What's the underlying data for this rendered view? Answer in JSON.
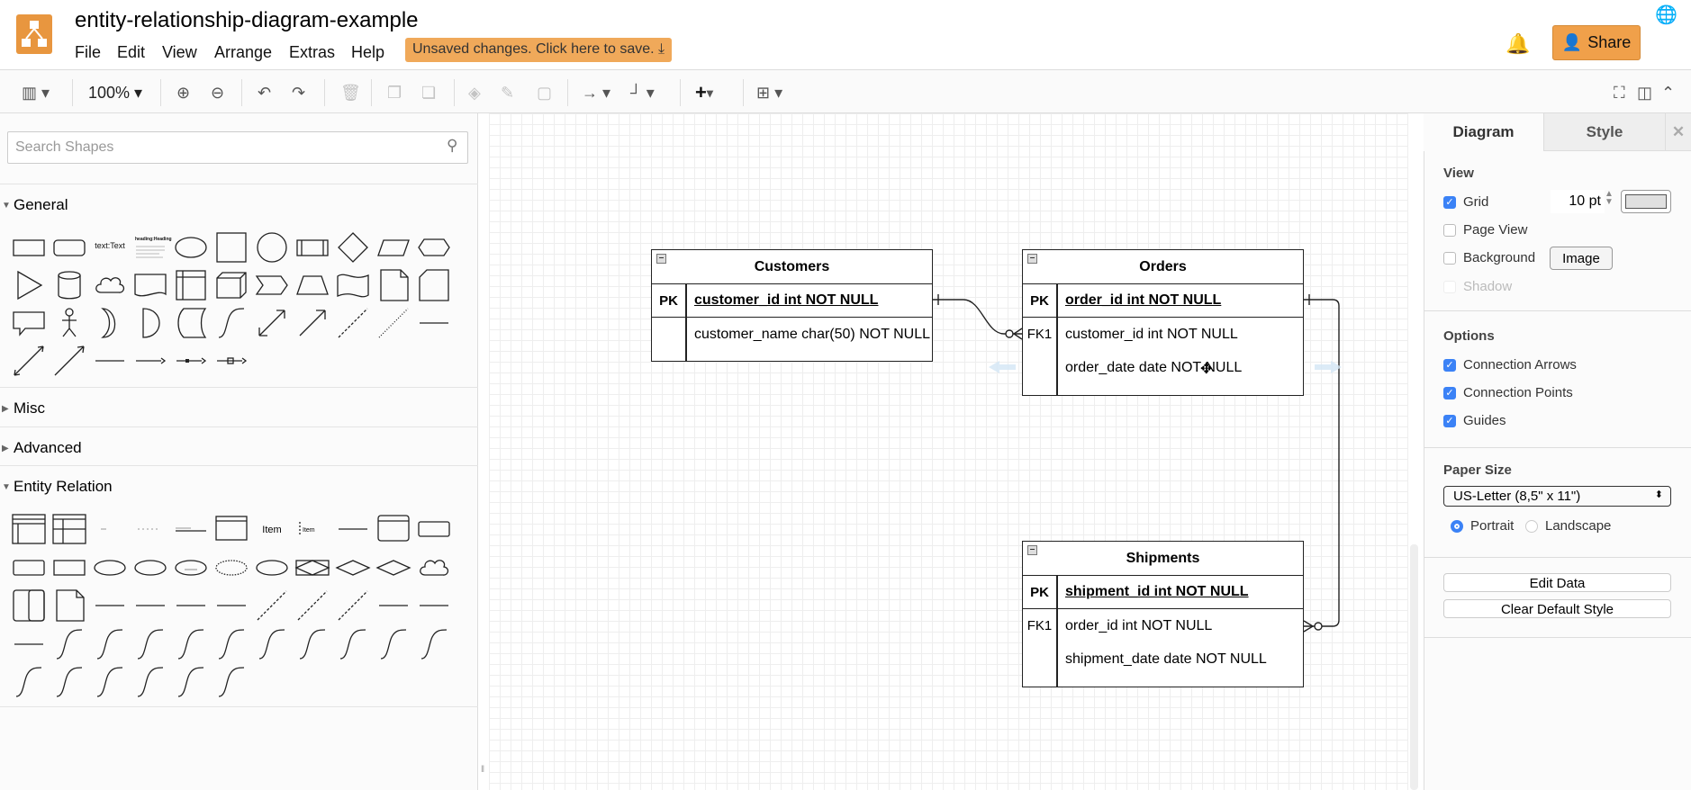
{
  "app": {
    "title": "entity-relationship-diagram-example",
    "unsaved": "Unsaved changes. Click here to save. ⤓",
    "share": "Share",
    "brand_color": "#e8963f"
  },
  "menu": [
    "File",
    "Edit",
    "View",
    "Arrange",
    "Extras",
    "Help"
  ],
  "toolbar": {
    "zoom": "100%"
  },
  "sidebar": {
    "search_placeholder": "Search Shapes",
    "sections": [
      "General",
      "Misc",
      "Advanced",
      "Entity Relation"
    ],
    "general_shapes": [
      "rect",
      "rounded",
      "text:Text",
      "heading:Heading",
      "ellipse",
      "square",
      "circle",
      "process",
      "diamond",
      "parallelogram",
      "hexagon",
      "triangle",
      "cylinder",
      "cloud",
      "document",
      "internal-storage",
      "cube",
      "step",
      "trapezoid",
      "tape",
      "note",
      "card",
      "callout",
      "actor",
      "or",
      "and",
      "data-storage",
      "curve",
      "bidir-arrow",
      "arrow",
      "dashed",
      "dotted",
      "line",
      "bidir-line",
      "dir-line",
      "thick-line",
      "dir-conn",
      "two-label-conn",
      "three-label-conn"
    ],
    "er_shapes": [
      "table",
      "table2",
      "row",
      "pkrow",
      "pkline",
      "list",
      "item:Item",
      "item2",
      "line",
      "entity-list",
      "entity",
      "entity",
      "entity-bold",
      "attribute",
      "attribute",
      "attribute-u",
      "attribute-dash",
      "attribute-bold",
      "assoc",
      "relationship",
      "relationship-bold",
      "cloud",
      "mainsub",
      "note",
      "line",
      "line",
      "line",
      "line",
      "dashed",
      "dashed",
      "dashed",
      "thick",
      "thick",
      "thick",
      "curve",
      "curve",
      "curve",
      "curve",
      "curve",
      "curve",
      "curve",
      "curve",
      "curve",
      "curve",
      "curve",
      "curve",
      "curve",
      "curve",
      "curve",
      "curve"
    ]
  },
  "diagram": {
    "tables": [
      {
        "name": "Customers",
        "rows": [
          {
            "key": "PK",
            "field": "customer_id int NOT NULL"
          },
          {
            "key": "",
            "field": "customer_name char(50) NOT NULL"
          }
        ]
      },
      {
        "name": "Orders",
        "rows": [
          {
            "key": "PK",
            "field": "order_id int NOT NULL"
          },
          {
            "key": "FK1",
            "field": "customer_id int NOT NULL"
          },
          {
            "key": "",
            "field": "order_date date NOT NULL"
          }
        ]
      },
      {
        "name": "Shipments",
        "rows": [
          {
            "key": "PK",
            "field": "shipment_id int NOT NULL"
          },
          {
            "key": "FK1",
            "field": "order_id int NOT NULL"
          },
          {
            "key": "",
            "field": "shipment_date date NOT NULL"
          }
        ]
      }
    ]
  },
  "panel": {
    "tabs": [
      "Diagram",
      "Style"
    ],
    "view": "View",
    "grid": "Grid",
    "grid_size": "10 pt",
    "page_view": "Page View",
    "background": "Background",
    "image": "Image",
    "shadow": "Shadow",
    "options": "Options",
    "conn_arrows": "Connection Arrows",
    "conn_points": "Connection Points",
    "guides": "Guides",
    "paper_size": "Paper Size",
    "paper_value": "US-Letter (8,5\" x 11\")",
    "portrait": "Portrait",
    "landscape": "Landscape",
    "edit_data": "Edit Data",
    "clear_style": "Clear Default Style"
  }
}
